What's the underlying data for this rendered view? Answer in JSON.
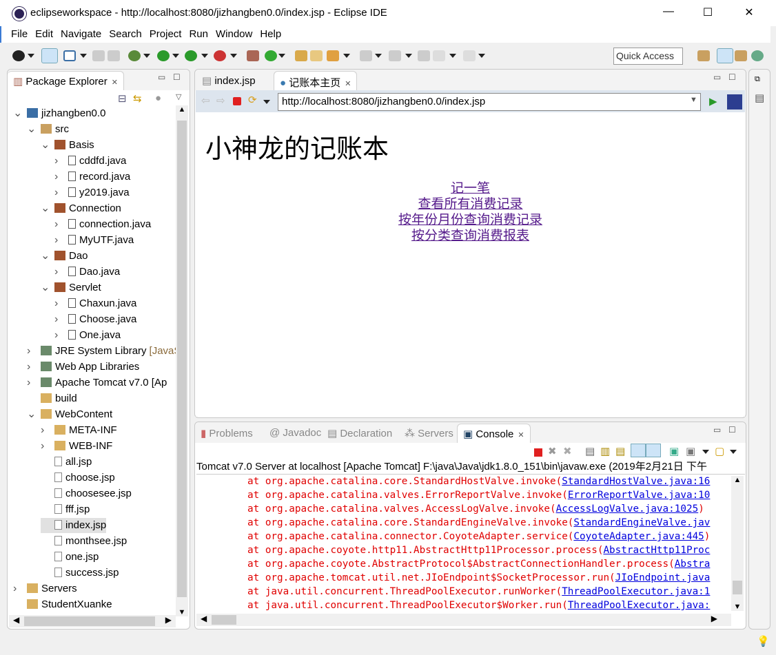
{
  "window": {
    "title": "eclipseworkspace - http://localhost:8080/jizhangben0.0/index.jsp - Eclipse IDE",
    "minimize": "—",
    "maximize": "☐",
    "close": "✕"
  },
  "menu": [
    "File",
    "Edit",
    "Navigate",
    "Search",
    "Project",
    "Run",
    "Window",
    "Help"
  ],
  "quick_access": "Quick Access",
  "package_explorer": {
    "title": "Package Explorer",
    "tree": [
      {
        "label": "jizhangben0.0",
        "level": 0,
        "arrow": "v",
        "icon": "project-icon"
      },
      {
        "label": "src",
        "level": 1,
        "arrow": "v",
        "icon": "source-folder-icon"
      },
      {
        "label": "Basis",
        "level": 2,
        "arrow": "v",
        "icon": "package-icon"
      },
      {
        "label": "cddfd.java",
        "level": 3,
        "arrow": ">",
        "icon": "java-file-icon"
      },
      {
        "label": "record.java",
        "level": 3,
        "arrow": ">",
        "icon": "java-file-icon"
      },
      {
        "label": "y2019.java",
        "level": 3,
        "arrow": ">",
        "icon": "java-file-icon"
      },
      {
        "label": "Connection",
        "level": 2,
        "arrow": "v",
        "icon": "package-icon"
      },
      {
        "label": "connection.java",
        "level": 3,
        "arrow": ">",
        "icon": "java-file-icon"
      },
      {
        "label": "MyUTF.java",
        "level": 3,
        "arrow": ">",
        "icon": "java-file-icon"
      },
      {
        "label": "Dao",
        "level": 2,
        "arrow": "v",
        "icon": "package-icon"
      },
      {
        "label": "Dao.java",
        "level": 3,
        "arrow": ">",
        "icon": "java-file-icon"
      },
      {
        "label": "Servlet",
        "level": 2,
        "arrow": "v",
        "icon": "package-icon"
      },
      {
        "label": "Chaxun.java",
        "level": 3,
        "arrow": ">",
        "icon": "java-file-icon"
      },
      {
        "label": "Choose.java",
        "level": 3,
        "arrow": ">",
        "icon": "java-file-icon"
      },
      {
        "label": "One.java",
        "level": 3,
        "arrow": ">",
        "icon": "java-file-icon"
      },
      {
        "label": "JRE System Library",
        "suffix": "[JavaS",
        "level": 1,
        "arrow": ">",
        "icon": "library-icon"
      },
      {
        "label": "Web App Libraries",
        "level": 1,
        "arrow": ">",
        "icon": "library-icon"
      },
      {
        "label": "Apache Tomcat v7.0 [Ap",
        "level": 1,
        "arrow": ">",
        "icon": "library-icon"
      },
      {
        "label": "build",
        "level": 1,
        "arrow": "",
        "icon": "folder-icon"
      },
      {
        "label": "WebContent",
        "level": 1,
        "arrow": "v",
        "icon": "folder-icon"
      },
      {
        "label": "META-INF",
        "level": 2,
        "arrow": ">",
        "icon": "folder-icon"
      },
      {
        "label": "WEB-INF",
        "level": 2,
        "arrow": ">",
        "icon": "folder-icon"
      },
      {
        "label": "all.jsp",
        "level": 2,
        "arrow": "",
        "icon": "jsp-file-icon"
      },
      {
        "label": "choose.jsp",
        "level": 2,
        "arrow": "",
        "icon": "jsp-file-icon"
      },
      {
        "label": "choosesee.jsp",
        "level": 2,
        "arrow": "",
        "icon": "jsp-file-icon"
      },
      {
        "label": "fff.jsp",
        "level": 2,
        "arrow": "",
        "icon": "jsp-file-icon"
      },
      {
        "label": "index.jsp",
        "level": 2,
        "arrow": "",
        "icon": "jsp-file-icon",
        "selected": true
      },
      {
        "label": "monthsee.jsp",
        "level": 2,
        "arrow": "",
        "icon": "jsp-file-icon"
      },
      {
        "label": "one.jsp",
        "level": 2,
        "arrow": "",
        "icon": "jsp-file-icon"
      },
      {
        "label": "success.jsp",
        "level": 2,
        "arrow": "",
        "icon": "jsp-file-icon"
      },
      {
        "label": "Servers",
        "level": 0,
        "arrow": ">",
        "icon": "folder-icon"
      },
      {
        "label": "StudentXuanke",
        "level": 0,
        "arrow": "",
        "icon": "folder-icon"
      }
    ]
  },
  "editor": {
    "tabs": [
      "index.jsp",
      "记账本主页"
    ],
    "url": "http://localhost:8080/jizhangben0.0/index.jsp",
    "page": {
      "heading": "小神龙的记账本",
      "links": [
        "记一笔",
        "查看所有消费记录",
        "按年份月份查询消费记录",
        "按分类查询消费报表"
      ]
    }
  },
  "console": {
    "tabs": [
      "Problems",
      "Javadoc",
      "Declaration",
      "Servers",
      "Console"
    ],
    "header": "Tomcat v7.0 Server at localhost [Apache Tomcat] F:\\java\\Java\\jdk1.8.0_151\\bin\\javaw.exe (2019年2月21日 下午",
    "lines": [
      {
        "text": "at org.apache.catalina.core.StandardHostValve.invoke(",
        "link": "StandardHostValve.java:16"
      },
      {
        "text": "at org.apache.catalina.valves.ErrorReportValve.invoke(",
        "link": "ErrorReportValve.java:10"
      },
      {
        "text": "at org.apache.catalina.valves.AccessLogValve.invoke(",
        "link": "AccessLogValve.java:1025",
        "tail": ")"
      },
      {
        "text": "at org.apache.catalina.core.StandardEngineValve.invoke(",
        "link": "StandardEngineValve.jav"
      },
      {
        "text": "at org.apache.catalina.connector.CoyoteAdapter.service(",
        "link": "CoyoteAdapter.java:445",
        "tail": ")"
      },
      {
        "text": "at org.apache.coyote.http11.AbstractHttp11Processor.process(",
        "link": "AbstractHttp11Proc"
      },
      {
        "text": "at org.apache.coyote.AbstractProtocol$AbstractConnectionHandler.process(",
        "link": "Abstra"
      },
      {
        "text": "at org.apache.tomcat.util.net.JIoEndpoint$SocketProcessor.run(",
        "link": "JIoEndpoint.java"
      },
      {
        "text": "at java.util.concurrent.ThreadPoolExecutor.runWorker(",
        "link": "ThreadPoolExecutor.java:1"
      },
      {
        "text": "at java.util.concurrent.ThreadPoolExecutor$Worker.run(",
        "link": "ThreadPoolExecutor.java:"
      }
    ]
  },
  "colors": {
    "accent": "#3b7bd4",
    "error": "#e00000",
    "link": "#0000dd",
    "visited": "#551a8b"
  }
}
